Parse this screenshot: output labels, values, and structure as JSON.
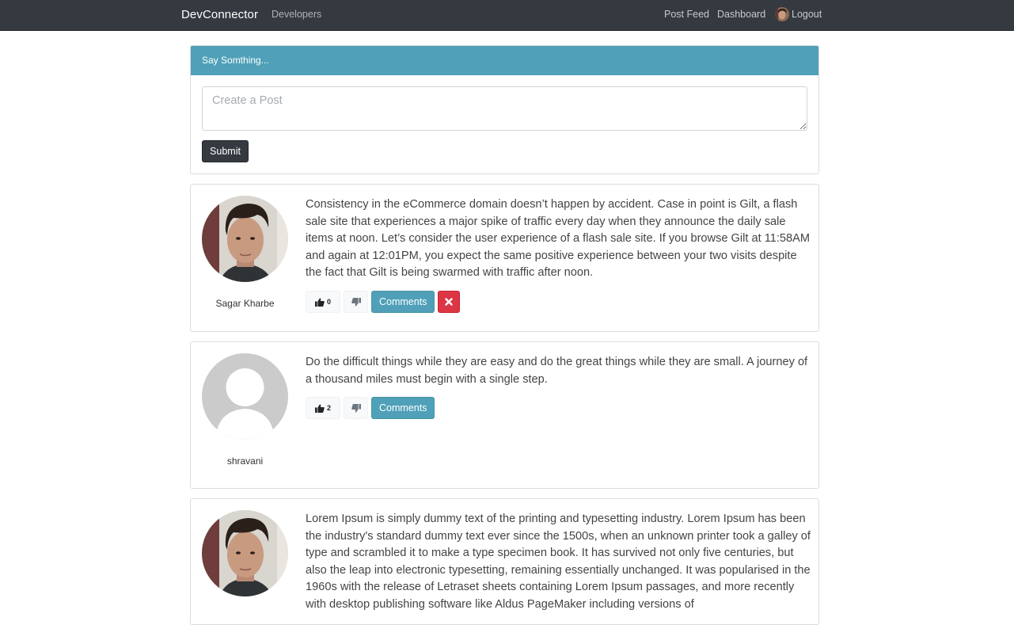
{
  "navbar": {
    "brand": "DevConnector",
    "developers_label": "Developers",
    "post_feed_label": "Post Feed",
    "dashboard_label": "Dashboard",
    "logout_label": "Logout"
  },
  "post_form": {
    "header": "Say Somthing...",
    "textarea_placeholder": "Create a Post",
    "submit_label": "Submit"
  },
  "posts": [
    {
      "author": "Sagar Kharbe",
      "avatar": "photo",
      "text": "Consistency in the eCommerce domain doesn’t happen by accident. Case in point is Gilt, a flash sale site that experiences a major spike of traffic every day when they announce the daily sale items at noon. Let’s consider the user experience of a flash sale site. If you browse Gilt at 11:58AM and again at 12:01PM, you expect the same positive experience between your two visits despite the fact that Gilt is being swarmed with traffic after noon.",
      "likes": "0",
      "comments_label": "Comments",
      "has_delete": true
    },
    {
      "author": "shravani",
      "avatar": "default",
      "text": "Do the difficult things while they are easy and do the great things while they are small. A journey of a thousand miles must begin with a single step.",
      "likes": "2",
      "comments_label": "Comments",
      "has_delete": false
    },
    {
      "author": "",
      "avatar": "photo",
      "text": "Lorem Ipsum is simply dummy text of the printing and typesetting industry. Lorem Ipsum has been the industry's standard dummy text ever since the 1500s, when an unknown printer took a galley of type and scrambled it to make a type specimen book. It has survived not only five centuries, but also the leap into electronic typesetting, remaining essentially unchanged. It was popularised in the 1960s with the release of Letraset sheets containing Lorem Ipsum passages, and more recently with desktop publishing software like Aldus PageMaker including versions of",
      "likes": "",
      "comments_label": "",
      "has_delete": false
    }
  ],
  "icons": {
    "like": "thumbs-up-icon",
    "unlike": "thumbs-down-icon",
    "delete": "times-icon"
  },
  "colors": {
    "navbar": "#343a40",
    "info": "#4fa0b8",
    "danger": "#dc3545",
    "dark_button": "#343a40"
  }
}
